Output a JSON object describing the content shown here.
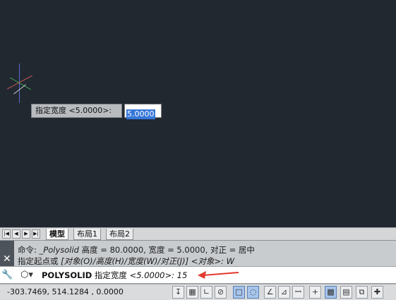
{
  "tooltip": {
    "text": "指定宽度 <5.0000>:"
  },
  "dynamic_input": {
    "value": "5.0000"
  },
  "layout_tabs": [
    {
      "label": "模型"
    },
    {
      "label": "布局1"
    },
    {
      "label": "布局2"
    }
  ],
  "nav_buttons": [
    "|◀",
    "◀",
    "▶",
    "▶|"
  ],
  "history": {
    "line1_prefix": "命令: ",
    "line1_cmd": "_Polysolid",
    "line1_rest": " 高度 = 80.0000, 宽度 = 5.0000, 对正 = 居中",
    "line2_prefix": "指定起点或 ",
    "line2_options": "[对象(O)/高度(H)/宽度(W)/对正(J)] <对象>: W"
  },
  "command_line": {
    "command": "POLYSOLID",
    "prompt": " 指定宽度 ",
    "default": "<5.0000>: ",
    "input": "15"
  },
  "status": {
    "coordinates": "-303.7469, 514.1284 , 0.0000"
  },
  "colors": {
    "canvas": "#212830",
    "selection": "#3576d8",
    "arrow": "#e23a2e"
  }
}
